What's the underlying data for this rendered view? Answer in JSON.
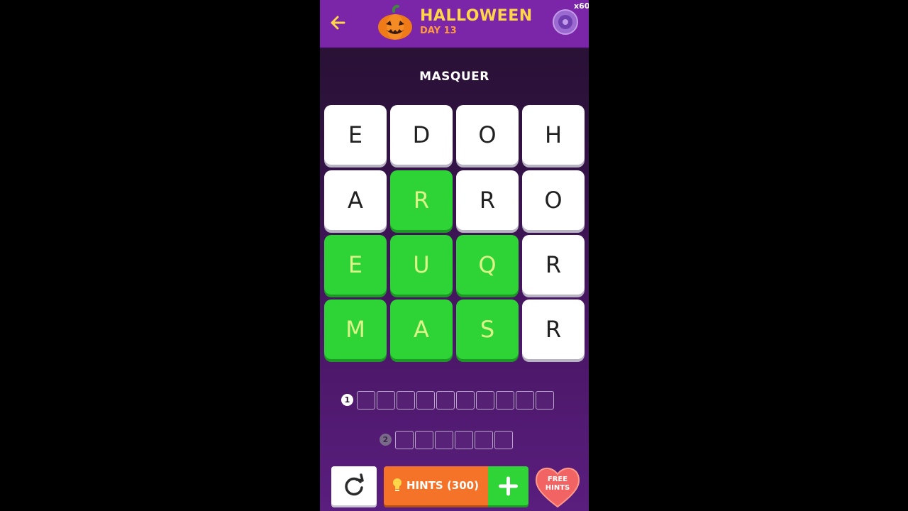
{
  "header": {
    "title": "HALLOWEEN",
    "day": "DAY 13",
    "coin_count": "x60"
  },
  "clue": "MASQUER",
  "grid": {
    "rows": [
      [
        {
          "letter": "E",
          "state": "empty"
        },
        {
          "letter": "D",
          "state": "empty"
        },
        {
          "letter": "O",
          "state": "empty"
        },
        {
          "letter": "H",
          "state": "empty"
        }
      ],
      [
        {
          "letter": "A",
          "state": "empty"
        },
        {
          "letter": "R",
          "state": "selected"
        },
        {
          "letter": "R",
          "state": "empty"
        },
        {
          "letter": "O",
          "state": "empty"
        }
      ],
      [
        {
          "letter": "E",
          "state": "selected"
        },
        {
          "letter": "U",
          "state": "selected"
        },
        {
          "letter": "Q",
          "state": "selected"
        },
        {
          "letter": "R",
          "state": "empty"
        }
      ],
      [
        {
          "letter": "M",
          "state": "selected"
        },
        {
          "letter": "A",
          "state": "selected"
        },
        {
          "letter": "S",
          "state": "selected"
        },
        {
          "letter": "R",
          "state": "empty"
        }
      ]
    ]
  },
  "answers": [
    {
      "number": "1",
      "length": 10,
      "active": true
    },
    {
      "number": "2",
      "length": 6,
      "active": false
    }
  ],
  "bottom": {
    "hints_label": "HINTS (300)",
    "free_hints_line1": "FREE",
    "free_hints_line2": "HINTS"
  },
  "icons": {
    "back": "back-arrow-icon",
    "pumpkin": "pumpkin-icon",
    "coin": "coin-icon",
    "reset": "refresh-icon",
    "bulb": "lightbulb-icon",
    "plus": "plus-icon",
    "heart": "heart-icon"
  },
  "colors": {
    "header": "#7b25a8",
    "title": "#ffd54a",
    "day": "#ff9a3a",
    "tile_selected": "#2ed436",
    "tile_selected_text": "#dcf58a",
    "hints_button": "#f47328",
    "plus_button": "#2fd436",
    "heart": "#f26363"
  }
}
